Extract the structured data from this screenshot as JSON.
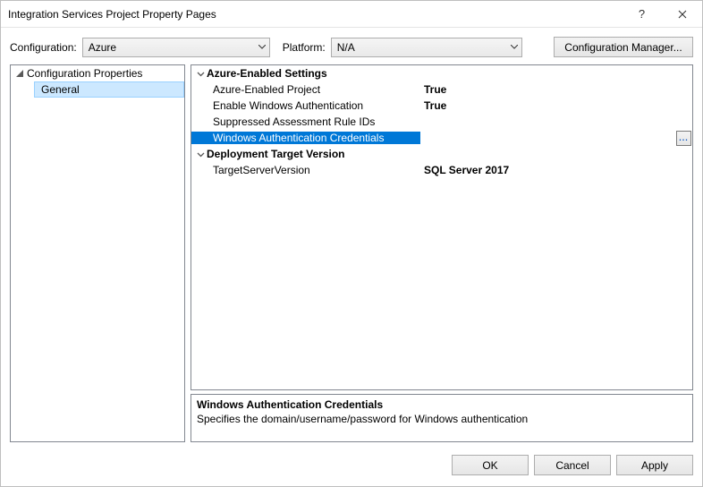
{
  "window": {
    "title": "Integration Services Project Property Pages"
  },
  "toolbar": {
    "configuration_label": "Configuration:",
    "configuration_value": "Azure",
    "platform_label": "Platform:",
    "platform_value": "N/A",
    "config_manager_label": "Configuration Manager..."
  },
  "tree": {
    "root_label": "Configuration Properties",
    "child_label": "General"
  },
  "grid": {
    "cat1": "Azure-Enabled Settings",
    "p1_name": "Azure-Enabled Project",
    "p1_val": "True",
    "p2_name": "Enable Windows Authentication",
    "p2_val": "True",
    "p3_name": "Suppressed Assessment Rule IDs",
    "p3_val": "",
    "p4_name": "Windows Authentication Credentials",
    "p4_val": "",
    "cat2": "Deployment Target Version",
    "p5_name": "TargetServerVersion",
    "p5_val": "SQL Server 2017",
    "ellipsis": "..."
  },
  "desc": {
    "heading": "Windows Authentication Credentials",
    "text": "Specifies the domain/username/password for Windows authentication"
  },
  "footer": {
    "ok": "OK",
    "cancel": "Cancel",
    "apply": "Apply"
  }
}
